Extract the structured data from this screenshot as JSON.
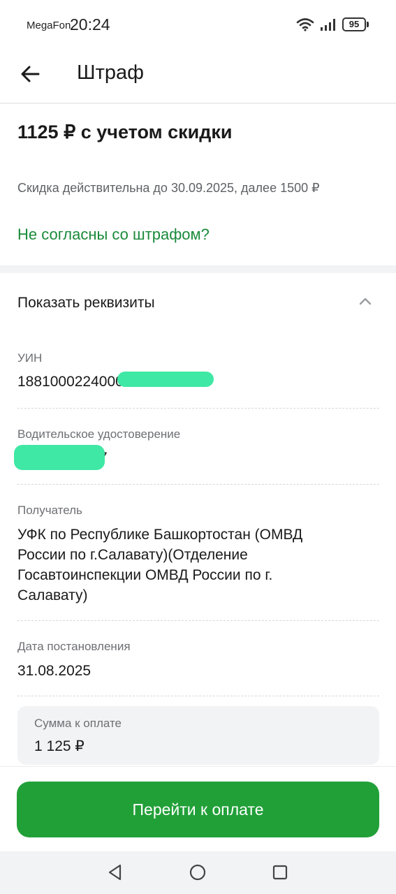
{
  "status_bar": {
    "carrier": "MegaFon",
    "time": "20:24",
    "battery": "95"
  },
  "header": {
    "title": "Штраф"
  },
  "summary": {
    "amount_title": "1125 ₽ с учетом скидки",
    "discount_note": "Скидка действительна до 30.09.2025, далее 1500 ₽",
    "dispute_link": "Не согласны со штрафом?"
  },
  "requisites": {
    "toggle_label": "Показать реквизиты",
    "uin": {
      "label": "УИН",
      "value": "18810002240000012140"
    },
    "license": {
      "label": "Водительское удостоверение",
      "value": "7"
    },
    "recipient": {
      "label": "Получатель",
      "lines": [
        "УФК по Республике Башкортостан (ОМВД",
        "России по г.Салавату)(Отделение",
        "Госавтоинспекции ОМВД России по г.",
        "Салавату)"
      ]
    },
    "date": {
      "label": "Дата постановления",
      "value": "31.08.2025"
    },
    "sum": {
      "label": "Сумма к оплате",
      "value": "1 125 ₽"
    }
  },
  "actions": {
    "pay_label": "Перейти к оплате"
  },
  "colors": {
    "accent": "#21a038",
    "link": "#1a8a3a",
    "redaction": "#3fe8a4"
  },
  "icons": [
    "back-arrow-icon",
    "chevron-up-icon",
    "wifi-icon",
    "signal-icon",
    "nav-back-icon",
    "nav-home-icon",
    "nav-recent-icon"
  ]
}
